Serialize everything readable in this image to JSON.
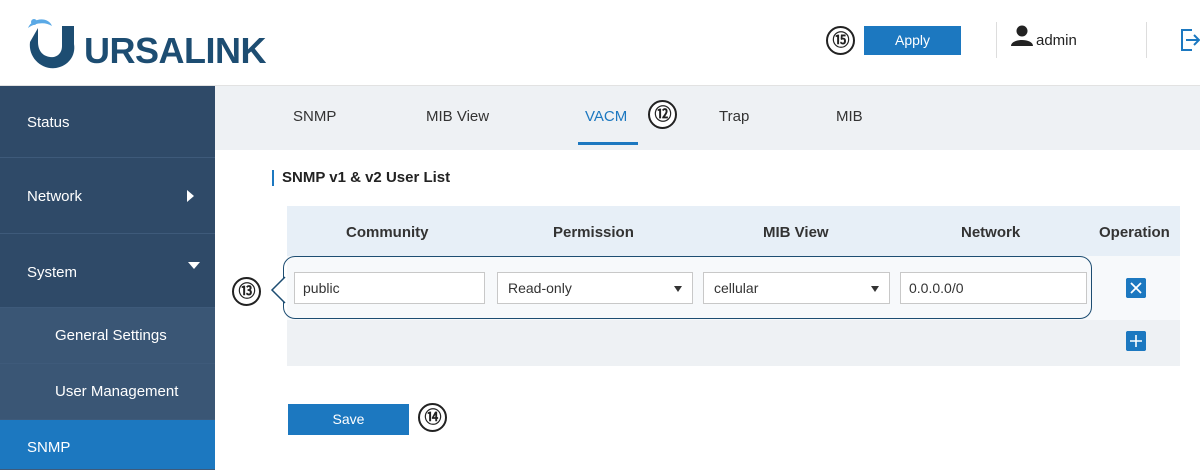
{
  "brand": {
    "name": "URSALINK"
  },
  "header": {
    "apply_label": "Apply",
    "apply_marker": "⑮",
    "username": "admin"
  },
  "sidebar": {
    "items": [
      {
        "label": "Status"
      },
      {
        "label": "Network"
      },
      {
        "label": "System"
      },
      {
        "label": "General Settings"
      },
      {
        "label": "User Management"
      },
      {
        "label": "SNMP"
      }
    ]
  },
  "tabs": [
    {
      "label": "SNMP"
    },
    {
      "label": "MIB View"
    },
    {
      "label": "VACM",
      "active": true
    },
    {
      "label": "Trap"
    },
    {
      "label": "MIB"
    }
  ],
  "tab_marker": "⑫",
  "section": {
    "title": "SNMP v1 & v2 User List"
  },
  "table": {
    "columns": [
      "Community",
      "Permission",
      "MIB View",
      "Network",
      "Operation"
    ],
    "row": {
      "community": "public",
      "permission": "Read-only",
      "mib_view": "cellular",
      "network": "0.0.0.0/0"
    },
    "row_marker": "⑬"
  },
  "save": {
    "label": "Save",
    "marker": "⑭"
  },
  "colors": {
    "accent": "#1c78c0",
    "sidebar": "#2f4a68",
    "brand": "#1d4d72"
  }
}
